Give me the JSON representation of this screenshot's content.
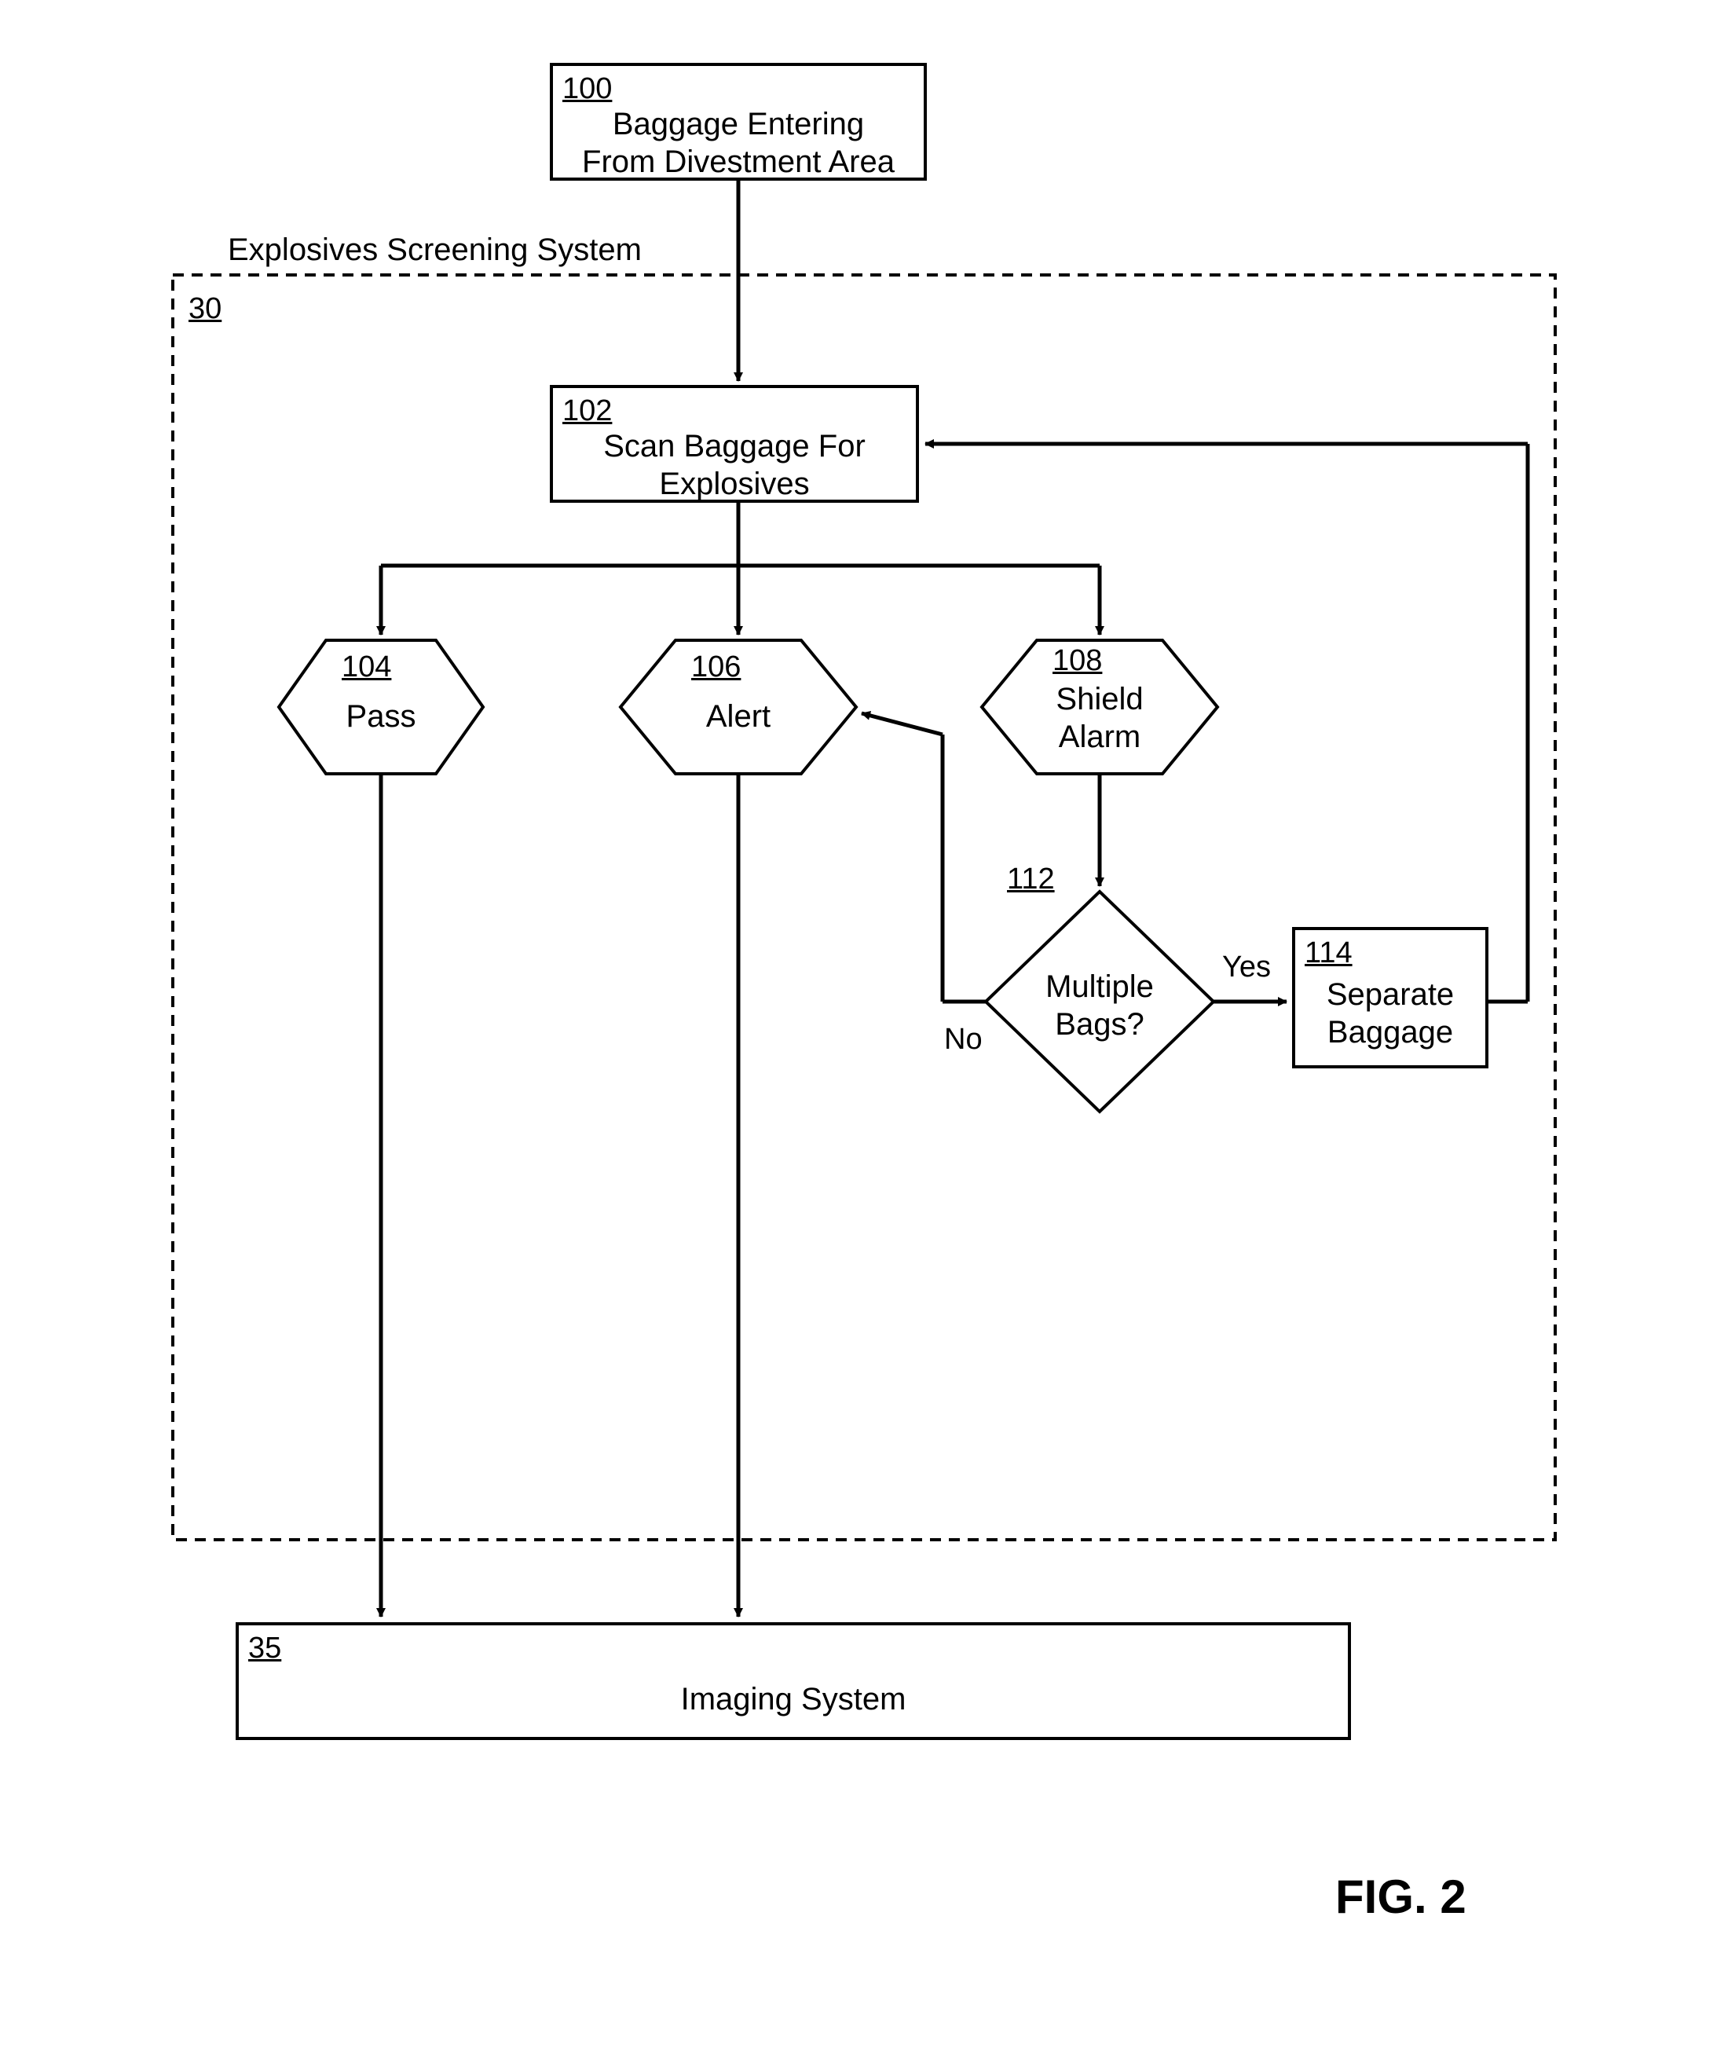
{
  "figure": "FIG. 2",
  "system": {
    "title": "Explosives Screening System",
    "ref": "30"
  },
  "nodes": {
    "n100": {
      "ref": "100",
      "text_l1": "Baggage Entering",
      "text_l2": "From Divestment Area"
    },
    "n102": {
      "ref": "102",
      "text_l1": "Scan Baggage For",
      "text_l2": "Explosives"
    },
    "n104": {
      "ref": "104",
      "text": "Pass"
    },
    "n106": {
      "ref": "106",
      "text": "Alert"
    },
    "n108": {
      "ref": "108",
      "text_l1": "Shield",
      "text_l2": "Alarm"
    },
    "n112": {
      "ref": "112",
      "text_l1": "Multiple",
      "text_l2": "Bags?"
    },
    "n114": {
      "ref": "114",
      "text_l1": "Separate",
      "text_l2": "Baggage"
    },
    "n35": {
      "ref": "35",
      "text": "Imaging System"
    }
  },
  "edges": {
    "n112_yes": "Yes",
    "n112_no": "No"
  }
}
